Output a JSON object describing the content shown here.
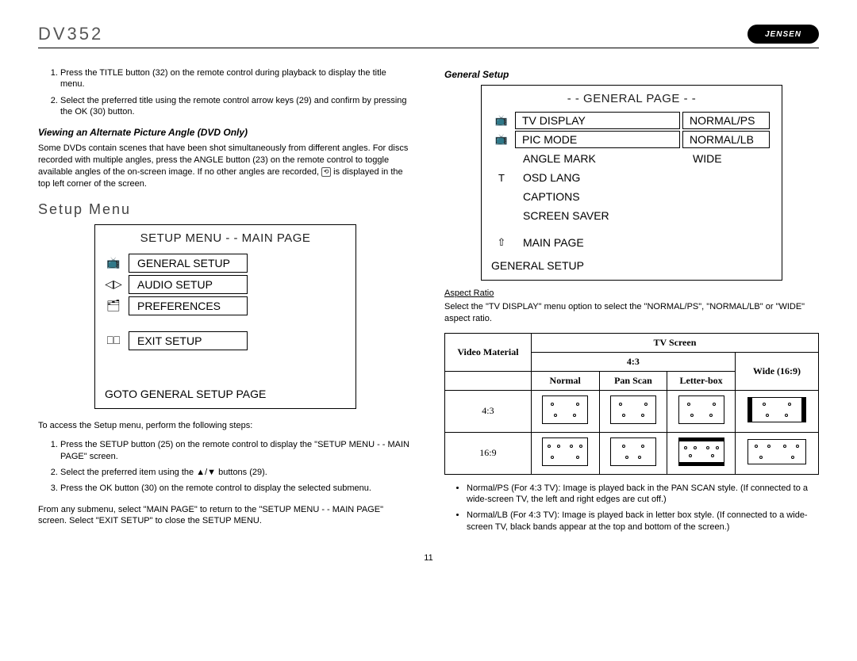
{
  "header": {
    "model": "DV352",
    "brand": "JENSEN"
  },
  "left": {
    "steps_top": [
      "Press the TITLE button (32) on the remote control during playback to display the title menu.",
      "Select the preferred title using the remote control arrow keys (29) and confirm by pressing the OK (30) button."
    ],
    "angle_heading": "Viewing an Alternate Picture Angle (DVD Only)",
    "angle_body_1": "Some DVDs contain scenes that have been shot simultaneously from different angles. For discs recorded with multiple angles, press the ANGLE button (23) on the remote control to toggle",
    "angle_body_2": "available angles of the on-screen image. If no other angles are recorded, ",
    "angle_body_3": " is displayed in the top left corner of the screen.",
    "setup_title": "Setup Menu",
    "menu": {
      "title": "SETUP MENU - - MAIN PAGE",
      "items": [
        "GENERAL SETUP",
        "AUDIO SETUP",
        "PREFERENCES"
      ],
      "exit": "EXIT SETUP",
      "footer": "GOTO GENERAL SETUP PAGE"
    },
    "access_text": "To access the Setup menu, perform the following steps:",
    "steps_bottom": [
      "Press the SETUP button (25) on the remote control to display the \"SETUP MENU - - MAIN PAGE\" screen.",
      "Select the preferred item using the ▲/▼ buttons (29).",
      "Press the OK button (30) on the remote control to display the selected submenu."
    ],
    "return_text": "From any submenu, select \"MAIN PAGE\" to return to the \"SETUP MENU - - MAIN PAGE\" screen. Select \"EXIT SETUP\" to close the SETUP MENU."
  },
  "right": {
    "general_heading": "General Setup",
    "general_page": {
      "title": "- - GENERAL PAGE - -",
      "rows": [
        {
          "label": "TV DISPLAY",
          "value": "NORMAL/PS",
          "boxed": true
        },
        {
          "label": "PIC MODE",
          "value": "NORMAL/LB",
          "boxed": true
        },
        {
          "label": "ANGLE MARK",
          "value": "WIDE",
          "boxed": false
        },
        {
          "label": "OSD LANG",
          "value": "",
          "boxed": false
        },
        {
          "label": "CAPTIONS",
          "value": "",
          "boxed": false
        },
        {
          "label": "SCREEN SAVER",
          "value": "",
          "boxed": false
        }
      ],
      "main_page": "MAIN PAGE",
      "footer": "GENERAL SETUP"
    },
    "aspect_heading": "Aspect Ratio",
    "aspect_body": "Select the \"TV DISPLAY\" menu option to select the \"NORMAL/PS\", \"NORMAL/LB\" or \"WIDE\" aspect ratio.",
    "table": {
      "video_material": "Video Material",
      "tv_screen": "TV Screen",
      "col43": "4:3",
      "wide": "Wide (16:9)",
      "normal": "Normal",
      "panscan": "Pan Scan",
      "letterbox": "Letter-box",
      "row43": "4:3",
      "row169": "16:9"
    },
    "bullets": [
      "Normal/PS (For 4:3 TV): Image is played back in the PAN SCAN style. (If connected to a wide-screen TV, the left and right edges are cut off.)",
      "Normal/LB (For 4:3 TV): Image is played back in letter box style. (If connected to a wide-screen TV, black bands appear at the top and bottom of the screen.)"
    ]
  },
  "page_number": "11"
}
